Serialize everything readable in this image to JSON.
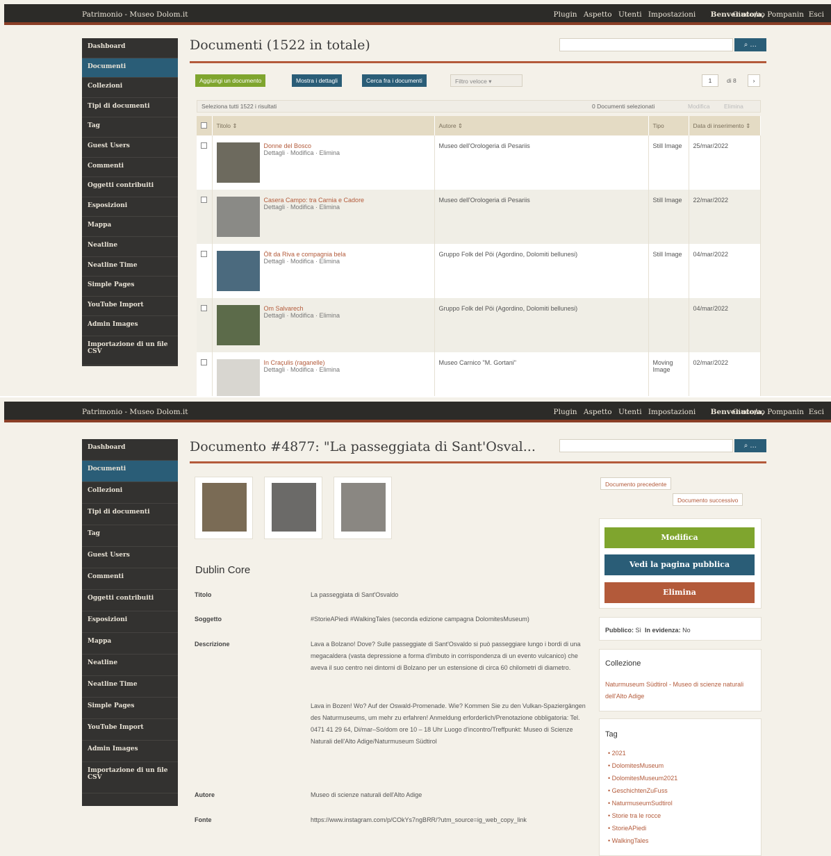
{
  "topbar": {
    "site": "Patrimonio - Museo Dolom.it",
    "nav": [
      "Plugin",
      "Aspetto",
      "Utenti",
      "Impostazioni"
    ],
    "welcome": "Benvenuto/a,",
    "user": "Giacomo Pompanin",
    "logout": "Esci"
  },
  "sidebar": [
    "Dashboard",
    "Documenti",
    "Collezioni",
    "Tipi di documenti",
    "Tag",
    "Guest Users",
    "Commenti",
    "Oggetti contribuiti",
    "Esposizioni",
    "Mappa",
    "Neatline",
    "Neatline Time",
    "Simple Pages",
    "YouTube Import",
    "Admin Images",
    "Importazione di un file CSV"
  ],
  "sidebar_active": "Documenti",
  "browse": {
    "title": "Documenti (1522 in totale)",
    "search_icon": "search-icon",
    "add_btn": "Aggiungi un documento",
    "details_btn": "Mostra i dettagli",
    "search_btn": "Cerca fra i documenti",
    "filter": "Filtro veloce",
    "page": "1",
    "page_of": "di 8",
    "select_all": "Seleziona tutti 1522 i risultati",
    "selected": "0 Documenti selezionati",
    "bulk_edit": "Modifica",
    "bulk_delete": "Elimina",
    "columns": [
      "Titolo ⇕",
      "Autore ⇕",
      "Tipo",
      "Data di inserimento ⇕"
    ],
    "actions": "Dettagli · Modifica · Elimina",
    "rows": [
      {
        "title": "Donne del Bosco",
        "author": "Museo dell'Orologeria di Pesariis",
        "type": "Still Image",
        "date": "25/mar/2022",
        "thumb": "#6d6a5e"
      },
      {
        "title": "Casera Campo: tra Carnia e Cadore",
        "author": "Museo dell'Orologeria di Pesariis",
        "type": "Still Image",
        "date": "22/mar/2022",
        "thumb": "#8a8a86"
      },
      {
        "title": "Ölt da Riva e compagnia bela",
        "author": "Gruppo Folk del Pöi (Agordino, Dolomiti bellunesi)",
        "type": "Still Image",
        "date": "04/mar/2022",
        "thumb": "#4b6a7e"
      },
      {
        "title": "Om Salvarech",
        "author": "Gruppo Folk del Pöi (Agordino, Dolomiti bellunesi)",
        "type": "",
        "date": "04/mar/2022",
        "thumb": "#5c6b4a"
      },
      {
        "title": "In Craçulis (raganelle)",
        "author": "Museo Carnico \"M. Gortani\"",
        "type": "Moving Image",
        "date": "02/mar/2022",
        "thumb": "#d8d6d0"
      }
    ]
  },
  "show": {
    "title": "Documento #4877: \"La passeggiata di Sant'Osval...",
    "prev": "Documento precedente",
    "next": "Documento successivo",
    "edit": "Modifica",
    "public": "Vedi la pagina pubblica",
    "delete": "Elimina",
    "public_label": "Pubblico:",
    "public_val": "Sì",
    "featured_label": "In evidenza:",
    "featured_val": "No",
    "collection_head": "Collezione",
    "collection": "Naturmuseum Südtirol - Museo di scienze naturali dell'Alto Adige",
    "tag_head": "Tag",
    "tags": [
      "2021",
      "DolomitesMuseum",
      "DolomitesMuseum2021",
      "GeschichtenZuFuss",
      "NaturmuseumSudtirol",
      "Storie tra le rocce",
      "StorieAPiedi",
      "WalkingTales"
    ],
    "dc_head": "Dublin Core",
    "dc": {
      "title_l": "Titolo",
      "title_v": "La passeggiata di Sant'Osvaldo",
      "subject_l": "Soggetto",
      "subject_v": "#StorieAPiedi #WalkingTales (seconda edizione campagna DolomitesMuseum)",
      "desc_l": "Descrizione",
      "desc_v1": "Lava a Bolzano! Dove? Sulle passeggiate di Sant'Osvaldo si può passeggiare lungo i bordi di una megacaldera (vasta depressione a forma d'imbuto in corrispondenza di un evento vulcanico) che aveva il suo centro nei dintorni di Bolzano per un estensione di circa 60 chilometri di diametro.",
      "desc_v2": "Lava in Bozen! Wo? Auf der Oswald-Promenade. Wie? Kommen Sie zu den Vulkan-Spaziergängen des Naturmuseums, um mehr zu erfahren! Anmeldung erforderlich/Prenotazione obbligatoria: Tel. 0471 41 29 64, Di/mar–So/dom ore 10 – 18 Uhr Luogo d'incontro/Treffpunkt: Museo di Scienze Naturali dell'Alto Adige/Naturmuseum Südtirol",
      "author_l": "Autore",
      "author_v": "Museo di scienze naturali dell'Alto Adige",
      "source_l": "Fonte",
      "source_v": "https://www.instagram.com/p/COkYs7ngBRR/?utm_source=ig_web_copy_link"
    },
    "images": [
      "#7a6b55",
      "#6b6a68",
      "#8a8782"
    ]
  }
}
